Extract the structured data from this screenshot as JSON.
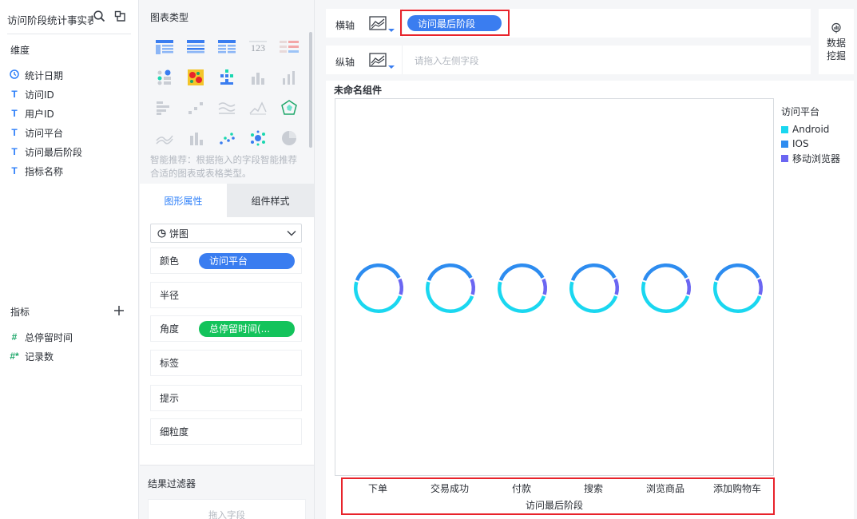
{
  "dataset": {
    "title": "访问阶段统计事实表"
  },
  "dimensions": {
    "title": "维度",
    "fields": [
      {
        "type": "date",
        "label": "统计日期"
      },
      {
        "type": "T",
        "label": "访问ID"
      },
      {
        "type": "T",
        "label": "用户ID"
      },
      {
        "type": "T",
        "label": "访问平台"
      },
      {
        "type": "T",
        "label": "访问最后阶段"
      },
      {
        "type": "T",
        "label": "指标名称"
      }
    ]
  },
  "measures": {
    "title": "指标",
    "fields": [
      {
        "type": "#",
        "label": "总停留时间"
      },
      {
        "type": "#*",
        "label": "记录数"
      }
    ]
  },
  "chart_types": {
    "title": "图表类型",
    "tip": "智能推荐：根据拖入的字段智能推荐合适的图表或表格类型。",
    "number_icon_text": "123"
  },
  "tabs": {
    "graph_props": "图形属性",
    "component_style": "组件样式"
  },
  "props": {
    "chart_select": "饼图",
    "color_label": "颜色",
    "color_field": "访问平台",
    "radius_label": "半径",
    "angle_label": "角度",
    "angle_field": "总停留时间(...",
    "tag_label": "标签",
    "tooltip_label": "提示",
    "granularity_label": "细粒度"
  },
  "filter": {
    "title": "结果过滤器",
    "placeholder": "拖入字段"
  },
  "axis": {
    "x_label": "横轴",
    "x_field": "访问最后阶段",
    "y_label": "纵轴",
    "y_placeholder": "请拖入左侧字段"
  },
  "mining": {
    "line1": "数据",
    "line2": "挖掘"
  },
  "component_title": "未命名组件",
  "colors": {
    "android": "#1ad7f0",
    "ios": "#2d8cf0",
    "mobile_browser": "#6b66f2",
    "accent": "#3a7df0",
    "highlight": "#e8232b"
  },
  "chart_data": {
    "type": "pie",
    "x_title": "访问最后阶段",
    "legend_title": "访问平台",
    "legend_position": "right",
    "categories": [
      "下单",
      "交易成功",
      "付款",
      "搜索",
      "浏览商品",
      "添加购物车"
    ],
    "series": [
      {
        "name": "Android",
        "values": [
          0.5,
          0.5,
          0.5,
          0.5,
          0.5,
          0.5
        ]
      },
      {
        "name": "IOS",
        "values": [
          0.38,
          0.38,
          0.38,
          0.38,
          0.38,
          0.38
        ]
      },
      {
        "name": "移动浏览器",
        "values": [
          0.12,
          0.12,
          0.12,
          0.12,
          0.12,
          0.12
        ]
      }
    ]
  }
}
